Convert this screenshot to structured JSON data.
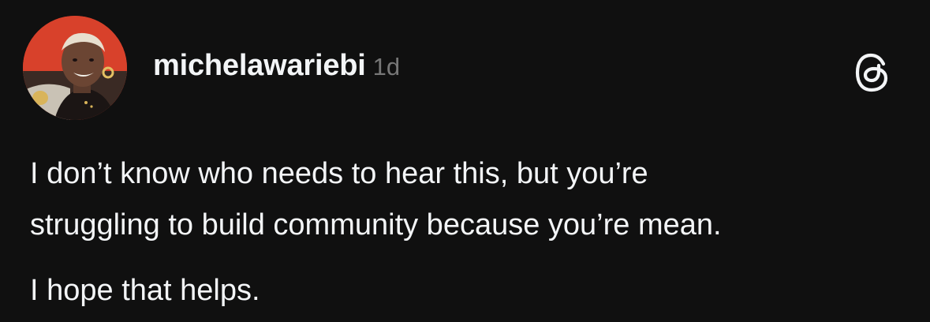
{
  "post": {
    "author": {
      "username": "michelawariebi",
      "avatar_icon": "profile-photo"
    },
    "timestamp": "1d",
    "platform_icon": "threads-logo-icon",
    "paragraphs": [
      "I don’t know who needs to hear this, but you’re",
      "struggling to build community because you’re mean.",
      "I hope that helps."
    ]
  },
  "colors": {
    "background": "#101010",
    "text_primary": "#f3f5f7",
    "text_secondary": "#777777",
    "avatar_backdrop": "#d8412b"
  }
}
